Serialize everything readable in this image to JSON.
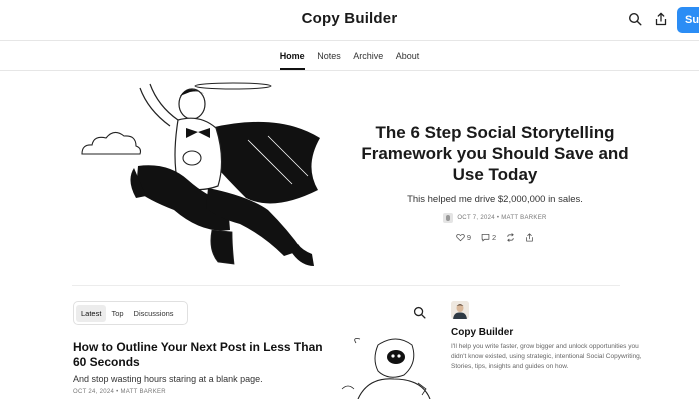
{
  "header": {
    "site_title": "Copy Builder",
    "subscribe_label": "Subscribe",
    "accent_color": "#2b8df5",
    "icons": [
      "search-icon",
      "share-icon"
    ]
  },
  "nav": {
    "items": [
      {
        "label": "Home",
        "active": true
      },
      {
        "label": "Notes",
        "active": false
      },
      {
        "label": "Archive",
        "active": false
      },
      {
        "label": "About",
        "active": false
      }
    ]
  },
  "hero": {
    "title": "The 6 Step Social Storytelling Framework you Should Save and Use Today",
    "subtitle": "This helped me drive $2,000,000 in sales.",
    "meta": "OCT 7, 2024 • MATT BARKER",
    "likes": "9",
    "comments": "2"
  },
  "feed": {
    "tabs": [
      {
        "label": "Latest",
        "active": true
      },
      {
        "label": "Top",
        "active": false
      },
      {
        "label": "Discussions",
        "active": false
      }
    ]
  },
  "post": {
    "title": "How to Outline Your Next Post in Less Than 60 Seconds",
    "subtitle": "And stop wasting hours staring at a blank page.",
    "meta": "OCT 24, 2024 • MATT BARKER"
  },
  "sidebar": {
    "name": "Copy Builder",
    "description": "I'll help you write faster, grow bigger and unlock opportunities you didn't know existed, using strategic, intentional Social Copywriting, Stories, tips, insights and guides on how."
  }
}
